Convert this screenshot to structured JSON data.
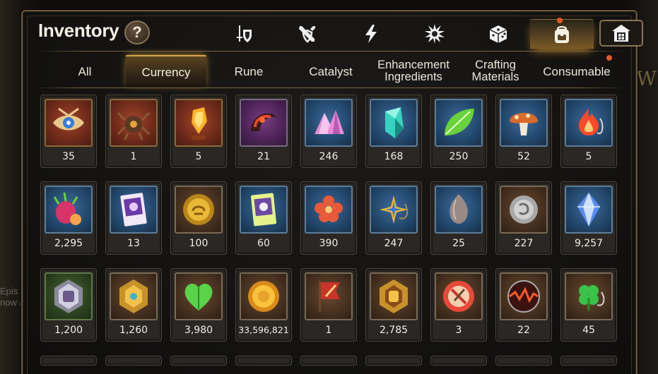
{
  "window": {
    "title": "Inventory",
    "help_label": "?"
  },
  "category_tabs": [
    {
      "icon": "sword-shield-icon",
      "active": false
    },
    {
      "icon": "crossed-swords-icon",
      "active": false
    },
    {
      "icon": "lightning-icon",
      "active": false
    },
    {
      "icon": "artifact-burst-icon",
      "active": false
    },
    {
      "icon": "dice-icon",
      "active": false
    },
    {
      "icon": "backpack-icon",
      "active": true,
      "notification": true
    },
    {
      "icon": "house-storage-icon",
      "active": false
    }
  ],
  "sub_tabs": [
    {
      "label": "All",
      "active": false
    },
    {
      "label": "Currency",
      "active": true
    },
    {
      "label": "Rune",
      "active": false
    },
    {
      "label": "Catalyst",
      "active": false
    },
    {
      "label": "Enhancement\nIngredients",
      "active": false
    },
    {
      "label": "Crafting\nMaterials",
      "active": false
    },
    {
      "label": "Consumable",
      "active": false,
      "notification": true
    }
  ],
  "items": [
    {
      "icon": "eye-emblem-icon",
      "rarity": "red",
      "count": "35"
    },
    {
      "icon": "spider-relic-icon",
      "rarity": "red",
      "count": "1"
    },
    {
      "icon": "fire-crystal-icon",
      "rarity": "red",
      "count": "5"
    },
    {
      "icon": "dark-horn-icon",
      "rarity": "purple",
      "count": "21"
    },
    {
      "icon": "crystal-cluster-icon",
      "rarity": "blue",
      "count": "246"
    },
    {
      "icon": "cyan-crystal-icon",
      "rarity": "blue",
      "count": "168"
    },
    {
      "icon": "leaf-icon",
      "rarity": "blue",
      "count": "250"
    },
    {
      "icon": "mushroom-icon",
      "rarity": "blue",
      "count": "52"
    },
    {
      "icon": "flame-charm-icon",
      "rarity": "blue",
      "count": "5"
    },
    {
      "icon": "dragonfruit-icon",
      "rarity": "blue",
      "count": "2,295"
    },
    {
      "icon": "purple-card-icon",
      "rarity": "blue",
      "count": "13"
    },
    {
      "icon": "gold-medal-icon",
      "rarity": "brown",
      "count": "100"
    },
    {
      "icon": "green-card-icon",
      "rarity": "blue",
      "count": "60"
    },
    {
      "icon": "red-flower-icon",
      "rarity": "blue",
      "count": "390"
    },
    {
      "icon": "star-pendant-icon",
      "rarity": "blue",
      "count": "247"
    },
    {
      "icon": "seed-icon",
      "rarity": "blue",
      "count": "25"
    },
    {
      "icon": "silver-coin-icon",
      "rarity": "brown",
      "count": "227"
    },
    {
      "icon": "blue-gem-icon",
      "rarity": "blue",
      "count": "9,257"
    },
    {
      "icon": "fist-badge-icon",
      "rarity": "green",
      "count": "1,200"
    },
    {
      "icon": "gold-hex-badge-icon",
      "rarity": "brown",
      "count": "1,260"
    },
    {
      "icon": "green-heart-icon",
      "rarity": "brown",
      "count": "3,980"
    },
    {
      "icon": "gold-coin-icon",
      "rarity": "brown",
      "count": "33,596,821"
    },
    {
      "icon": "flag-sword-icon",
      "rarity": "brown",
      "count": "1"
    },
    {
      "icon": "fist-hex-badge-icon",
      "rarity": "brown",
      "count": "2,785"
    },
    {
      "icon": "no-sword-seal-icon",
      "rarity": "brown",
      "count": "3"
    },
    {
      "icon": "lava-orb-icon",
      "rarity": "brown",
      "count": "22"
    },
    {
      "icon": "clover-charm-icon",
      "rarity": "brown",
      "count": "45"
    }
  ],
  "background_text": {
    "left": "Epis\nnow a",
    "right": "W"
  },
  "colors": {
    "gold_accent": "#d6a848",
    "notification": "#e25a1f",
    "panel": "#121110"
  }
}
